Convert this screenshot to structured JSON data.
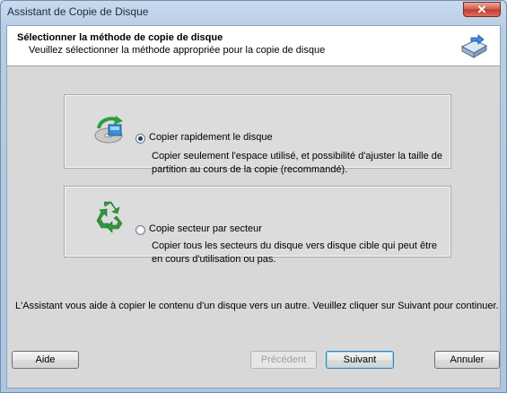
{
  "window": {
    "title": "Assistant de Copie de Disque",
    "close_label": "✕"
  },
  "header": {
    "title": "Sélectionner la méthode de copie de disque",
    "subtitle": "Veuillez sélectionner la méthode appropriée pour la copie de disque",
    "icon": "disk-copy-icon"
  },
  "options": [
    {
      "label": "Copier rapidement le disque",
      "description": "Copier seulement l'espace utilisé, et possibilité d'ajuster la taille de partition au cours de la copie (recommandé).",
      "selected": true,
      "icon": "quick-copy-icon"
    },
    {
      "label": "Copie secteur par secteur",
      "description": "Copier tous les secteurs du disque vers disque cible qui peut être en cours d'utilisation ou pas.",
      "selected": false,
      "icon": "recycle-icon"
    }
  ],
  "footer": {
    "text": "L'Assistant vous aide à copier le contenu d'un disque vers un autre. Veuillez cliquer sur Suivant pour continuer."
  },
  "buttons": {
    "help": "Aide",
    "previous": "Précédent",
    "next": "Suivant",
    "cancel": "Annuler"
  },
  "colors": {
    "accent": "#1f3b6a",
    "recycle_green": "#2e9a3a"
  }
}
